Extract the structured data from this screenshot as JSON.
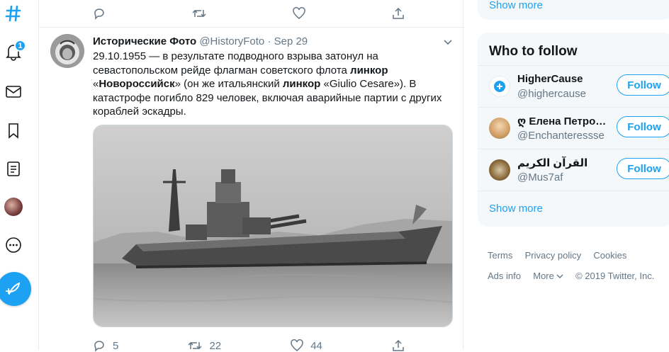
{
  "nav": {
    "notification_count": "1",
    "icons": [
      "hashtag-icon",
      "bell-icon",
      "mail-icon",
      "bookmark-icon",
      "list-icon",
      "profile-avatar",
      "more-icon",
      "compose-tweet-icon"
    ]
  },
  "prev_tweet": {
    "reply_count": "",
    "retweet_count": "",
    "like_count": ""
  },
  "tweet": {
    "display_name": "Исторические Фото",
    "handle": "@HistoryFoto",
    "dot": "·",
    "date": "Sep 29",
    "text_parts": [
      "29.10.1955 — в результате подводного взрыва затонул на севастопольском рейде флагман советского флота ",
      "линкор",
      " «",
      "Новороссийск",
      "» (он же итальянский ",
      "линкор",
      " «Giulio Cesare»). В катастрофе погибло 829 человек, включая аварийные партии с других кораблей эскадры."
    ],
    "reply_count": "5",
    "retweet_count": "22",
    "like_count": "44"
  },
  "sidebar": {
    "show_more_top": "Show more",
    "who_to_follow_title": "Who to follow",
    "suggestions": [
      {
        "name": "HigherCause",
        "handle": "@highercause",
        "button": "Follow"
      },
      {
        "name": "ღ Елена Петро…",
        "handle": "@Enchanteressse",
        "button": "Follow"
      },
      {
        "name": "القرآن الكريم",
        "handle": "@Mus7af",
        "button": "Follow"
      }
    ],
    "show_more_bottom": "Show more"
  },
  "footer": {
    "terms": "Terms",
    "privacy": "Privacy policy",
    "cookies": "Cookies",
    "ads": "Ads info",
    "more": "More",
    "copyright": "© 2019 Twitter, Inc."
  },
  "colors": {
    "accent": "#1da1f2",
    "muted": "#657786",
    "border": "#e6ecf0",
    "panel": "#f5f8fa"
  }
}
